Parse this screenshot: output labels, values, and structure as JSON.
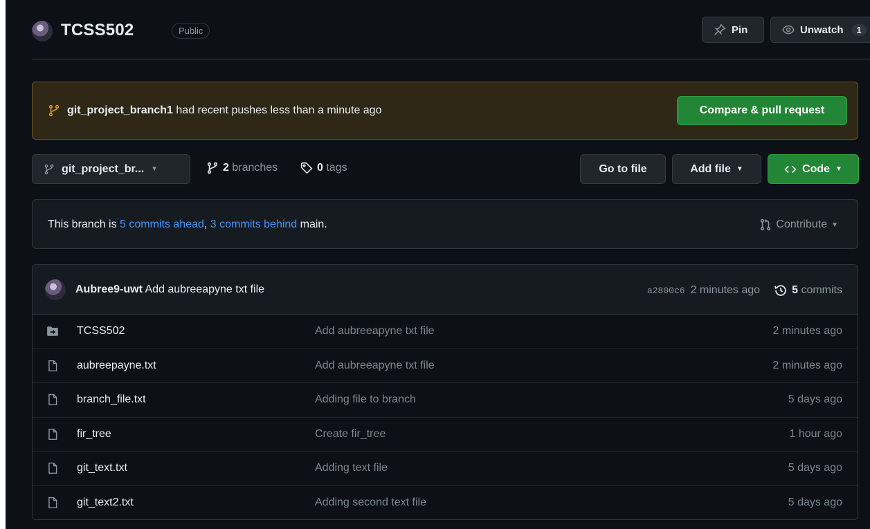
{
  "colors": {
    "background": "#0d1117",
    "accent_green": "#238636",
    "link_blue": "#4493f8",
    "banner_bg": "#2f2817",
    "muted": "#8b949e"
  },
  "header": {
    "repo_name": "TCSS502",
    "visibility": "Public",
    "pin_label": "Pin",
    "unwatch_label": "Unwatch",
    "watch_count": "1"
  },
  "banner": {
    "branch": "git_project_branch1",
    "message": "had recent pushes less than a minute ago",
    "button_label": "Compare & pull request"
  },
  "branch_bar": {
    "current_branch": "git_project_br...",
    "branches_count": "2",
    "branches_label": "branches",
    "tags_count": "0",
    "tags_label": "tags",
    "goto_file_label": "Go to file",
    "add_file_label": "Add file",
    "code_label": "Code"
  },
  "ahead_behind": {
    "prefix": "This branch is",
    "ahead": "5 commits ahead",
    "separator": ",",
    "behind": "3 commits behind",
    "suffix": "main.",
    "contribute_label": "Contribute"
  },
  "latest_commit": {
    "author": "Aubree9-uwt",
    "message": "Add aubreeapyne txt file",
    "sha": "a2800c6",
    "time": "2 minutes ago",
    "commits_count": "5",
    "commits_label": "commits"
  },
  "files": [
    {
      "icon": "folder-submodule-icon",
      "name": "TCSS502",
      "commit": "Add aubreeapyne txt file",
      "date": "2 minutes ago"
    },
    {
      "icon": "file-icon",
      "name": "aubreepayne.txt",
      "commit": "Add aubreeapyne txt file",
      "date": "2 minutes ago"
    },
    {
      "icon": "file-icon",
      "name": "branch_file.txt",
      "commit": "Adding file to branch",
      "date": "5 days ago"
    },
    {
      "icon": "file-icon",
      "name": "fir_tree",
      "commit": "Create fir_tree",
      "date": "1 hour ago"
    },
    {
      "icon": "file-icon",
      "name": "git_text.txt",
      "commit": "Adding text file",
      "date": "5 days ago"
    },
    {
      "icon": "file-icon",
      "name": "git_text2.txt",
      "commit": "Adding second text file",
      "date": "5 days ago"
    }
  ]
}
